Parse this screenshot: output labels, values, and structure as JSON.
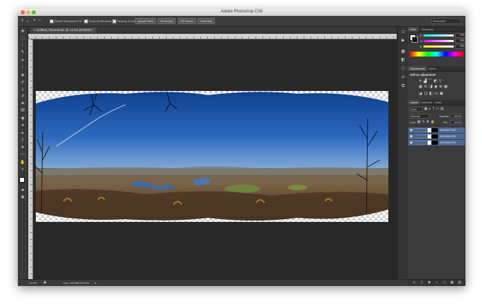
{
  "window": {
    "title": "Adobe Photoshop CS6",
    "traffic_lights": {
      "close": "#fc5b57",
      "minimize": "#e5bf3c",
      "zoom": "#57c038"
    }
  },
  "options_bar": {
    "zoom_tool_icon": "magnifier-icon",
    "zoom_in_label": "+",
    "zoom_out_label": "−",
    "resize_windows_label": "Resize Windows to Fit",
    "zoom_all_windows_label": "Zoom All Windows",
    "scrubby_zoom_label": "Scrubby Zoom",
    "actual_pixels_label": "Actual Pixels",
    "fit_screen_label": "Fit Screen",
    "fill_screen_label": "Fill Screen",
    "print_size_label": "Print Size",
    "workspace_label": "Essentials"
  },
  "document": {
    "tab_label": "Untitled_Panorama1 @ 12.5% (RGB/8*) *",
    "tab_close": "×",
    "checker_color": "#cfcfcf"
  },
  "status_bar": {
    "zoom": "12.5%",
    "doc_info": "Doc: 118.8M/376.2M",
    "arrow": "▸"
  },
  "tools": [
    "move-tool-icon",
    "marquee-tool-icon",
    "lasso-tool-icon",
    "quick-select-tool-icon",
    "crop-tool-icon",
    "eyedropper-tool-icon",
    "healing-tool-icon",
    "brush-tool-icon",
    "stamp-tool-icon",
    "history-brush-tool-icon",
    "eraser-tool-icon",
    "gradient-tool-icon",
    "blur-tool-icon",
    "dodge-tool-icon",
    "pen-tool-icon",
    "type-tool-icon",
    "path-select-tool-icon",
    "shape-tool-icon",
    "hand-tool-icon",
    "zoom-tool-icon"
  ],
  "panels": {
    "color": {
      "tabs": [
        "Color",
        "Swatches"
      ],
      "r_label": "R",
      "g_label": "G",
      "b_label": "B",
      "r_value": "255",
      "g_value": "255",
      "b_value": "255"
    },
    "adjustments": {
      "tabs": [
        "Adjustments",
        "Styles"
      ],
      "heading": "Add an adjustment"
    },
    "layers": {
      "tabs": [
        "Layers",
        "Channels",
        "Paths"
      ],
      "filter_kind": "Kind",
      "blend_mode": "Normal",
      "opacity_label": "Opacity:",
      "opacity_value": "100%",
      "lock_label": "Lock:",
      "fill_label": "Fill:",
      "fill_value": "100%",
      "items": [
        {
          "name": "IMG4067.CR2"
        },
        {
          "name": "IMG4068.CR2"
        },
        {
          "name": "IMG4069.CR2"
        }
      ]
    }
  }
}
